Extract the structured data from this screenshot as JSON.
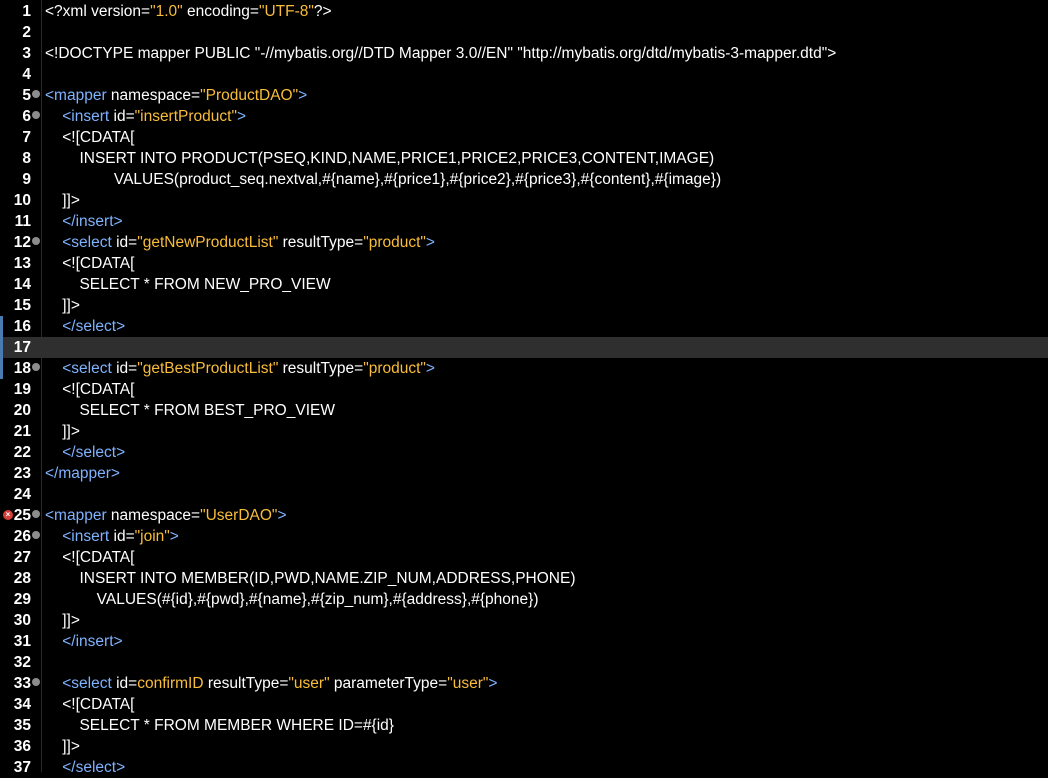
{
  "colors": {
    "background": "#000000",
    "text": "#ffffff",
    "tag": "#7fb2ff",
    "attribute_value": "#f9bd3a",
    "current_line": "#2f2f2f",
    "error_marker": "#d43f3a"
  },
  "editor": {
    "current_line": 17,
    "error_line": 25,
    "fold_lines": [
      5,
      6,
      12,
      18,
      25,
      26,
      33
    ],
    "changed_lines": [
      16,
      17,
      18
    ],
    "lines": [
      {
        "n": "1",
        "segs": [
          [
            "w",
            "<?xml version="
          ],
          [
            "v",
            "\"1.0\""
          ],
          [
            "w",
            " encoding="
          ],
          [
            "v",
            "\"UTF-8\""
          ],
          [
            "w",
            "?>"
          ]
        ]
      },
      {
        "n": "2",
        "segs": []
      },
      {
        "n": "3",
        "segs": [
          [
            "w",
            "<!DOCTYPE mapper PUBLIC \"-//mybatis.org//DTD Mapper 3.0//EN\" \"http://mybatis.org/dtd/mybatis-3-mapper.dtd\">"
          ]
        ]
      },
      {
        "n": "4",
        "segs": []
      },
      {
        "n": "5",
        "segs": [
          [
            "t",
            "<mapper "
          ],
          [
            "a",
            "namespace="
          ],
          [
            "v",
            "\"ProductDAO\""
          ],
          [
            "t",
            ">"
          ]
        ]
      },
      {
        "n": "6",
        "segs": [
          [
            "w",
            "    "
          ],
          [
            "t",
            "<insert "
          ],
          [
            "a",
            "id="
          ],
          [
            "v",
            "\"insertProduct\""
          ],
          [
            "t",
            ">"
          ]
        ]
      },
      {
        "n": "7",
        "segs": [
          [
            "w",
            "    <![CDATA["
          ]
        ]
      },
      {
        "n": "8",
        "segs": [
          [
            "w",
            "        INSERT INTO PRODUCT(PSEQ,KIND,NAME,PRICE1,PRICE2,PRICE3,CONTENT,IMAGE)"
          ]
        ]
      },
      {
        "n": "9",
        "segs": [
          [
            "w",
            "                VALUES(product_seq.nextval,#{name},#{price1},#{price2},#{price3},#{content},#{image})"
          ]
        ]
      },
      {
        "n": "10",
        "segs": [
          [
            "w",
            "    ]]>"
          ]
        ]
      },
      {
        "n": "11",
        "segs": [
          [
            "w",
            "    "
          ],
          [
            "t",
            "</insert>"
          ]
        ]
      },
      {
        "n": "12",
        "segs": [
          [
            "w",
            "    "
          ],
          [
            "t",
            "<select "
          ],
          [
            "a",
            "id="
          ],
          [
            "v",
            "\"getNewProductList\""
          ],
          [
            "a",
            " resultType="
          ],
          [
            "v",
            "\"product\""
          ],
          [
            "t",
            ">"
          ]
        ]
      },
      {
        "n": "13",
        "segs": [
          [
            "w",
            "    <![CDATA["
          ]
        ]
      },
      {
        "n": "14",
        "segs": [
          [
            "w",
            "        SELECT * FROM NEW_PRO_VIEW"
          ]
        ]
      },
      {
        "n": "15",
        "segs": [
          [
            "w",
            "    ]]>"
          ]
        ]
      },
      {
        "n": "16",
        "segs": [
          [
            "w",
            "    "
          ],
          [
            "t",
            "</select>"
          ]
        ]
      },
      {
        "n": "17",
        "segs": []
      },
      {
        "n": "18",
        "segs": [
          [
            "w",
            "    "
          ],
          [
            "t",
            "<select "
          ],
          [
            "a",
            "id="
          ],
          [
            "v",
            "\"getBestProductList\""
          ],
          [
            "a",
            " resultType="
          ],
          [
            "v",
            "\"product\""
          ],
          [
            "t",
            ">"
          ]
        ]
      },
      {
        "n": "19",
        "segs": [
          [
            "w",
            "    <![CDATA["
          ]
        ]
      },
      {
        "n": "20",
        "segs": [
          [
            "w",
            "        SELECT * FROM BEST_PRO_VIEW"
          ]
        ]
      },
      {
        "n": "21",
        "segs": [
          [
            "w",
            "    ]]>"
          ]
        ]
      },
      {
        "n": "22",
        "segs": [
          [
            "w",
            "    "
          ],
          [
            "t",
            "</select>"
          ]
        ]
      },
      {
        "n": "23",
        "segs": [
          [
            "t",
            "</mapper>"
          ]
        ]
      },
      {
        "n": "24",
        "segs": []
      },
      {
        "n": "25",
        "segs": [
          [
            "t",
            "<mapper "
          ],
          [
            "a",
            "namespace="
          ],
          [
            "v",
            "\"UserDAO\""
          ],
          [
            "t",
            ">"
          ]
        ]
      },
      {
        "n": "26",
        "segs": [
          [
            "w",
            "    "
          ],
          [
            "t",
            "<insert "
          ],
          [
            "a",
            "id="
          ],
          [
            "v",
            "\"join\""
          ],
          [
            "t",
            ">"
          ]
        ]
      },
      {
        "n": "27",
        "segs": [
          [
            "w",
            "    <![CDATA["
          ]
        ]
      },
      {
        "n": "28",
        "segs": [
          [
            "w",
            "        INSERT INTO MEMBER(ID,PWD,NAME.ZIP_NUM,ADDRESS,PHONE)"
          ]
        ]
      },
      {
        "n": "29",
        "segs": [
          [
            "w",
            "            VALUES(#{id},#{pwd},#{name},#{zip_num},#{address},#{phone})"
          ]
        ]
      },
      {
        "n": "30",
        "segs": [
          [
            "w",
            "    ]]>"
          ]
        ]
      },
      {
        "n": "31",
        "segs": [
          [
            "w",
            "    "
          ],
          [
            "t",
            "</insert>"
          ]
        ]
      },
      {
        "n": "32",
        "segs": []
      },
      {
        "n": "33",
        "segs": [
          [
            "w",
            "    "
          ],
          [
            "t",
            "<select "
          ],
          [
            "a",
            "id="
          ],
          [
            "v",
            "confirmID"
          ],
          [
            "a",
            " resultType="
          ],
          [
            "v",
            "\"user\""
          ],
          [
            "a",
            " parameterType="
          ],
          [
            "v",
            "\"user\""
          ],
          [
            "t",
            ">"
          ]
        ]
      },
      {
        "n": "34",
        "segs": [
          [
            "w",
            "    <![CDATA["
          ]
        ]
      },
      {
        "n": "35",
        "segs": [
          [
            "w",
            "        SELECT * FROM MEMBER WHERE ID=#{id}"
          ]
        ]
      },
      {
        "n": "36",
        "segs": [
          [
            "w",
            "    ]]>"
          ]
        ]
      },
      {
        "n": "37",
        "segs": [
          [
            "w",
            "    "
          ],
          [
            "t",
            "</select>"
          ]
        ]
      }
    ]
  }
}
